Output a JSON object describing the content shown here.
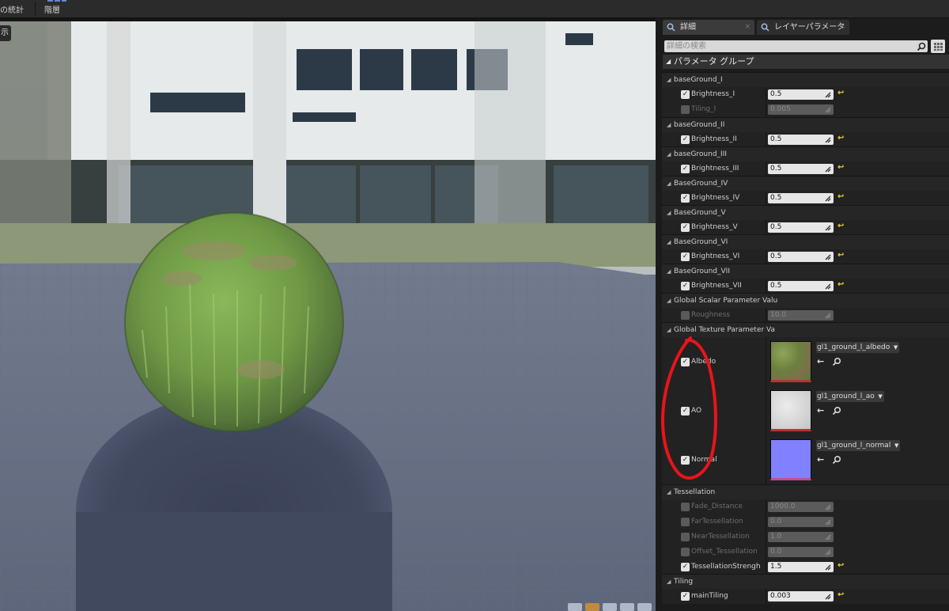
{
  "toolbar": {
    "stats_label": "の統計",
    "hierarchy_label": "階層"
  },
  "viewport": {
    "left_clipped_label": "示"
  },
  "panel": {
    "tabs": [
      {
        "label": "詳細"
      },
      {
        "label": "レイヤーパラメータ"
      }
    ],
    "search_placeholder": "詳細の検索",
    "group_header": "パラメータ グループ"
  },
  "groups": {
    "g1": {
      "title": "baseGround_I"
    },
    "g2": {
      "title": "baseGround_II"
    },
    "g3": {
      "title": "baseGround_III"
    },
    "g4": {
      "title": "BaseGround_IV"
    },
    "g5": {
      "title": "BaseGround_V"
    },
    "g6": {
      "title": "BaseGround_VI"
    },
    "g7": {
      "title": "BaseGround_VII"
    },
    "g8": {
      "title": "Global Scalar Parameter Valu"
    },
    "g9": {
      "title": "Global Texture Parameter Va"
    },
    "g10": {
      "title": "Tessellation"
    },
    "g11": {
      "title": "Tiling"
    }
  },
  "params": {
    "brightness_i": {
      "name": "Brightness_I",
      "value": "0.5"
    },
    "tiling_i": {
      "name": "Tiling_I",
      "value": "0.005"
    },
    "brightness_ii": {
      "name": "Brightness_II",
      "value": "0.5"
    },
    "brightness_iii": {
      "name": "Brightness_III",
      "value": "0.5"
    },
    "brightness_iv": {
      "name": "Brightness_IV",
      "value": "0.5"
    },
    "brightness_v": {
      "name": "Brightness_V",
      "value": "0.5"
    },
    "brightness_vi": {
      "name": "Brightness_VI",
      "value": "0.5"
    },
    "brightness_vii": {
      "name": "Brightness_VII",
      "value": "0.5"
    },
    "roughness": {
      "name": "Roughness",
      "value": "10.0"
    },
    "fade_distance": {
      "name": "Fade_Distance",
      "value": "1000.0"
    },
    "far_tess": {
      "name": "FarTessellation",
      "value": "0.0"
    },
    "near_tess": {
      "name": "NearTessellation",
      "value": "1.0"
    },
    "offset_tess": {
      "name": "Offset_Tessellation",
      "value": "0.0"
    },
    "tess_strength": {
      "name": "TessellationStrengh",
      "value": "1.5"
    },
    "main_tiling": {
      "name": "mainTiling",
      "value": "0.003"
    }
  },
  "textures": {
    "albedo": {
      "name": "Albedo",
      "asset": "gl1_ground_l_albedo"
    },
    "ao": {
      "name": "AO",
      "asset": "gl1_ground_l_ao"
    },
    "normal": {
      "name": "Normal",
      "asset": "gl1_ground_l_normal"
    }
  },
  "icons": {
    "reset": "↩",
    "back": "←",
    "search": "⌕"
  },
  "colors": {
    "reset_arrow": "#e7d240",
    "annotation_loop": "#e8141a",
    "normal_map": "#8080ff"
  }
}
